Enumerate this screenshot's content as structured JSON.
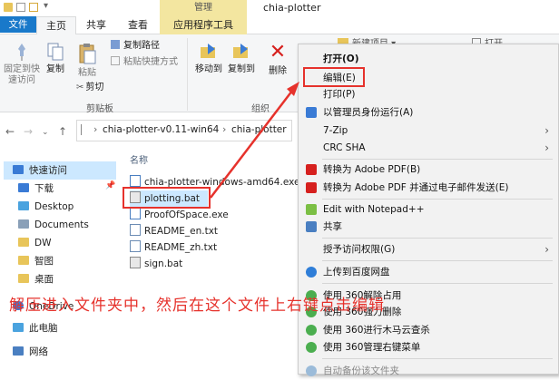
{
  "window": {
    "manage_tab": "管理",
    "title": "chia-plotter"
  },
  "tabs": [
    "文件",
    "主页",
    "共享",
    "查看",
    "应用程序工具"
  ],
  "ribbon": {
    "pin": "固定到快\n速访问",
    "copy": "复制",
    "paste": "粘贴",
    "copy_path": "复制路径",
    "paste_shortcut": "粘贴快捷方式",
    "cut": "剪切",
    "move_to": "移动到",
    "copy_to": "复制到",
    "delete": "删除",
    "new_folder": "新建项目",
    "clipboard_group": "剪贴板",
    "organize_group": "组织",
    "open_label": "打开"
  },
  "address": {
    "path1": "chia-plotter-v0.11-win64",
    "path2": "chia-plotter"
  },
  "nav": {
    "items": [
      "快速访问",
      "下载",
      "Desktop",
      "Documents",
      "DW",
      "智图",
      "桌面",
      "OneDrive",
      "此电脑",
      "网络"
    ]
  },
  "files": {
    "column_name": "名称",
    "items": [
      "chia-plotter-windows-amd64.exe",
      "plotting.bat",
      "ProofOfSpace.exe",
      "README_en.txt",
      "README_zh.txt",
      "sign.bat"
    ]
  },
  "context_menu": {
    "items": [
      "打开(O)",
      "编辑(E)",
      "打印(P)",
      "以管理员身份运行(A)",
      "7-Zip",
      "CRC SHA",
      "转换为 Adobe PDF(B)",
      "转换为 Adobe PDF 并通过电子邮件发送(E)",
      "Edit with Notepad++",
      "共享",
      "授予访问权限(G)",
      "上传到百度网盘",
      "使用 360解除占用",
      "使用 360强力删除",
      "使用 360进行木马云查杀",
      "使用 360管理右键菜单",
      "自动备份该文件夹"
    ]
  },
  "annotation": {
    "caption": "解压进入文件夹中，然后在这个文件上右键点击编辑"
  },
  "colors": {
    "accent": "#1979ca",
    "annotation": "#e6322c",
    "selection": "#cce8ff"
  }
}
